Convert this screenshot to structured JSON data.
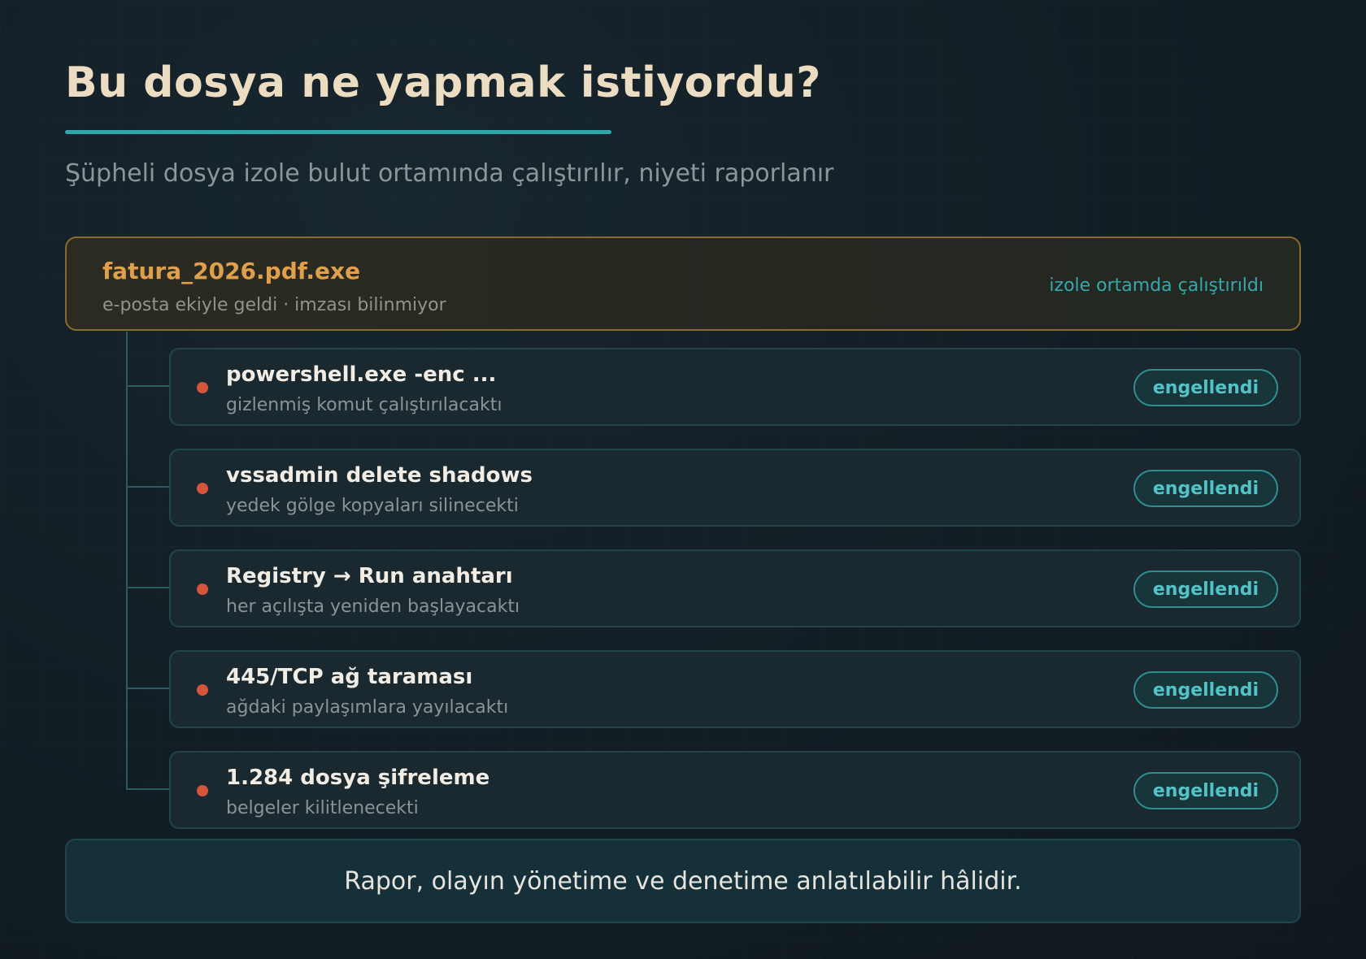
{
  "header": {
    "title": "Bu dosya ne yapmak istiyordu?",
    "subtitle": "Şüpheli dosya izole bulut ortamında çalıştırılır, niyeti raporlanır"
  },
  "file": {
    "name": "fatura_2026.pdf.exe",
    "meta": "e-posta ekiyle geldi · imzası bilinmiyor",
    "status": "izole ortamda çalıştırıldı"
  },
  "steps": [
    {
      "title": "powershell.exe -enc ...",
      "desc": "gizlenmiş komut çalıştırılacaktı",
      "badge": "engellendi"
    },
    {
      "title": "vssadmin delete shadows",
      "desc": "yedek gölge kopyaları silinecekti",
      "badge": "engellendi"
    },
    {
      "title": "Registry → Run anahtarı",
      "desc": "her açılışta yeniden başlayacaktı",
      "badge": "engellendi"
    },
    {
      "title": "445/TCP ağ taraması",
      "desc": "ağdaki paylaşımlara yayılacaktı",
      "badge": "engellendi"
    },
    {
      "title": "1.284 dosya şifreleme",
      "desc": "belgeler kilitlenecekti",
      "badge": "engellendi"
    }
  ],
  "footer": {
    "text": "Rapor, olayın yönetime ve denetime anlatılabilir hâlidir."
  },
  "colors": {
    "accent": "#2fa6ac",
    "file_border": "#8a6a31",
    "file_name": "#e0a04b",
    "danger_dot": "#d4553c",
    "badge_text": "#52c3c7"
  }
}
